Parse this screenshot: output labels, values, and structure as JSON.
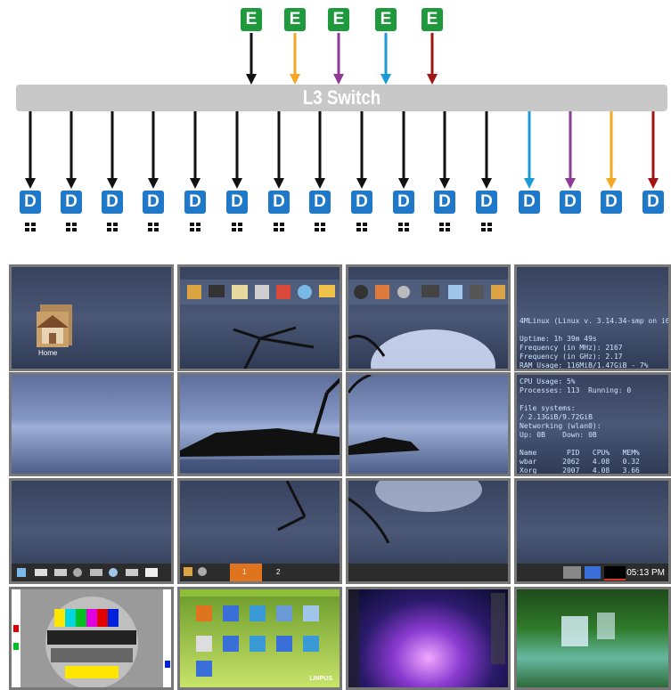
{
  "encoders": [
    {
      "label": "E",
      "arrow_color": "#111111"
    },
    {
      "label": "E",
      "arrow_color": "#f5a623"
    },
    {
      "label": "E",
      "arrow_color": "#8e3a96"
    },
    {
      "label": "E",
      "arrow_color": "#1a9ad6"
    },
    {
      "label": "E",
      "arrow_color": "#a01414"
    }
  ],
  "switch": {
    "label": "L3 Switch"
  },
  "decoders": [
    {
      "label": "D",
      "arrow_color": "#111111",
      "windows_icon": true
    },
    {
      "label": "D",
      "arrow_color": "#111111",
      "windows_icon": true
    },
    {
      "label": "D",
      "arrow_color": "#111111",
      "windows_icon": true
    },
    {
      "label": "D",
      "arrow_color": "#111111",
      "windows_icon": true
    },
    {
      "label": "D",
      "arrow_color": "#111111",
      "windows_icon": true
    },
    {
      "label": "D",
      "arrow_color": "#111111",
      "windows_icon": true
    },
    {
      "label": "D",
      "arrow_color": "#111111",
      "windows_icon": true
    },
    {
      "label": "D",
      "arrow_color": "#111111",
      "windows_icon": true
    },
    {
      "label": "D",
      "arrow_color": "#111111",
      "windows_icon": true
    },
    {
      "label": "D",
      "arrow_color": "#111111",
      "windows_icon": true
    },
    {
      "label": "D",
      "arrow_color": "#111111",
      "windows_icon": true
    },
    {
      "label": "D",
      "arrow_color": "#111111",
      "windows_icon": true
    },
    {
      "label": "D",
      "arrow_color": "#1a9ad6",
      "windows_icon": false
    },
    {
      "label": "D",
      "arrow_color": "#8e3a96",
      "windows_icon": false
    },
    {
      "label": "D",
      "arrow_color": "#f5a623",
      "windows_icon": false
    },
    {
      "label": "D",
      "arrow_color": "#a01414",
      "windows_icon": false
    }
  ],
  "wall": {
    "home_label": "Home",
    "pager": [
      "1",
      "2"
    ],
    "clock": "05:13 PM",
    "sysinfo_top": "4MLinux (Linux v. 3.14.34-smp on i686)\n\nUptime: 1h 39m 49s\nFrequency (in MHz): 2167\nFrequency (in GHz): 2.17\nRAM Usage: 116MiB/1.47GiB - 7%",
    "sysinfo_mid": "CPU Usage: 5%\nProcesses: 113  Running: 0\n\nFile systems:\n/ 2.13GiB/9.72GiB\nNetworking (wlan0):\nUp: 0B    Down: 0B\n\nName       PID   CPU%   MEM%\nwbar      2062   4.08   0.32\nXorg      2007   4.08   3.66\nsleep     3678   0.00   0.02",
    "linpus_label": "LINPUS"
  }
}
